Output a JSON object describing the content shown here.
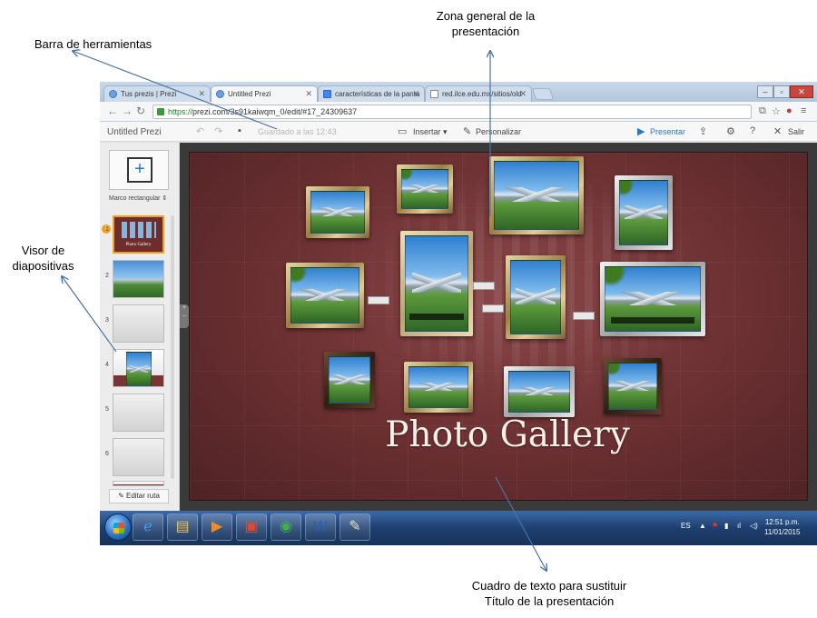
{
  "annotations": {
    "toolbar": "Barra de herramientas",
    "general_zone": [
      "Zona  general de la",
      "presentación"
    ],
    "slide_viewer": [
      "Visor de",
      "diapositivas"
    ],
    "textbox": [
      "Cuadro de texto para sustituir",
      "Título de la presentación"
    ]
  },
  "browser": {
    "tabs": [
      {
        "label": "Tus prezis | Prezi",
        "icon": "prezi-favicon"
      },
      {
        "label": "Untitled Prezi",
        "icon": "prezi-favicon",
        "active": true
      },
      {
        "label": "características de la panta",
        "icon": "google-favicon"
      },
      {
        "label": "red.ilce.edu.mx/sitios/old",
        "icon": "page-favicon"
      }
    ],
    "url_scheme": "https://",
    "url_rest": "prezi.com/3s91kaiwqm_0/edit/#17_24309637"
  },
  "toolbar": {
    "title": "Untitled Prezi",
    "saved": "Guardado a las 12:43",
    "insert": "Insertar",
    "customize": "Personalizar",
    "present": "Presentar",
    "exit": "Salir"
  },
  "sidebar": {
    "frame_label": "Marco rectangular",
    "slides": [
      {
        "num": "1",
        "kind": "overview",
        "title": "Photo Gallery"
      },
      {
        "num": "2",
        "kind": "photo"
      },
      {
        "num": "3",
        "kind": "blank"
      },
      {
        "num": "4",
        "kind": "photo"
      },
      {
        "num": "5",
        "kind": "blank"
      },
      {
        "num": "6",
        "kind": "blank"
      }
    ],
    "edit_path": "Editar ruta"
  },
  "canvas": {
    "title": "Photo Gallery"
  },
  "taskbar": {
    "language": "ES",
    "time": "12:51 p.m.",
    "date": "11/01/2015"
  }
}
